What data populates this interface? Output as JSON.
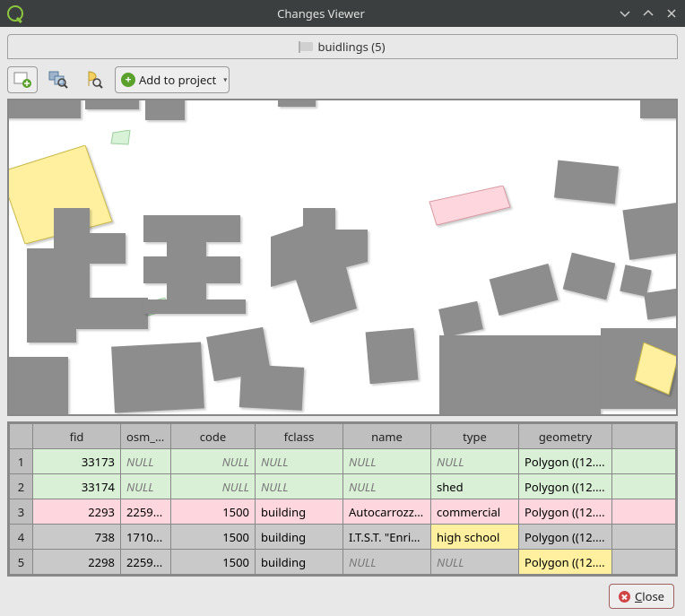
{
  "window": {
    "title": "Changes Viewer"
  },
  "tab": {
    "label": "buidlings (5)"
  },
  "toolbar": {
    "add_to_project": "Add to project"
  },
  "table": {
    "columns": [
      "fid",
      "osm_id",
      "code",
      "fclass",
      "name",
      "type",
      "geometry"
    ],
    "rows": [
      {
        "n": "1",
        "cls": "bg-green",
        "cells": [
          {
            "v": "33173",
            "num": true
          },
          {
            "v": "NULL",
            "null": true
          },
          {
            "v": "NULL",
            "null": true,
            "num": true
          },
          {
            "v": "NULL",
            "null": true
          },
          {
            "v": "NULL",
            "null": true
          },
          {
            "v": "NULL",
            "null": true
          },
          {
            "v": "Polygon ((12...."
          }
        ]
      },
      {
        "n": "2",
        "cls": "bg-green",
        "cells": [
          {
            "v": "33174",
            "num": true
          },
          {
            "v": "NULL",
            "null": true
          },
          {
            "v": "NULL",
            "null": true,
            "num": true
          },
          {
            "v": "NULL",
            "null": true
          },
          {
            "v": "NULL",
            "null": true
          },
          {
            "v": "shed"
          },
          {
            "v": "Polygon ((12...."
          }
        ]
      },
      {
        "n": "3",
        "cls": "bg-pink",
        "cells": [
          {
            "v": "2293",
            "num": true
          },
          {
            "v": "2259..."
          },
          {
            "v": "1500",
            "num": true
          },
          {
            "v": "building"
          },
          {
            "v": "Autocarrozze..."
          },
          {
            "v": "commercial"
          },
          {
            "v": "Polygon ((12...."
          }
        ]
      },
      {
        "n": "4",
        "cls": "bg-grey",
        "cells": [
          {
            "v": "738",
            "num": true
          },
          {
            "v": "1710..."
          },
          {
            "v": "1500",
            "num": true
          },
          {
            "v": "building"
          },
          {
            "v": "I.T.S.T. \"Enric..."
          },
          {
            "v": "high school",
            "hl": true
          },
          {
            "v": "Polygon ((12...."
          }
        ]
      },
      {
        "n": "5",
        "cls": "bg-grey",
        "cells": [
          {
            "v": "2298",
            "num": true
          },
          {
            "v": "2259..."
          },
          {
            "v": "1500",
            "num": true
          },
          {
            "v": "building"
          },
          {
            "v": "NULL",
            "null": true
          },
          {
            "v": "NULL",
            "null": true
          },
          {
            "v": "Polygon ((12....",
            "hl": true
          }
        ]
      }
    ]
  },
  "footer": {
    "close": "Close"
  },
  "colors": {
    "accent": "#8cc63f",
    "row_green": "#d9f0d6",
    "row_pink": "#fdd7dd",
    "cell_yellow": "#fff0a0"
  }
}
